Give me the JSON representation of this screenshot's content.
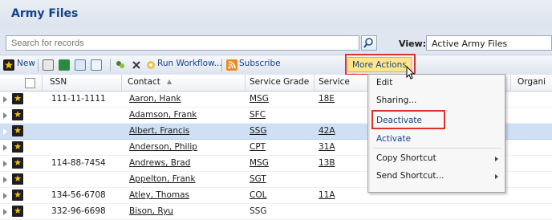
{
  "header": {
    "title": "Army Files"
  },
  "search": {
    "placeholder": "Search for records",
    "view_label": "View:",
    "view_value": "Active Army Files"
  },
  "toolbar": {
    "new_label": "New",
    "run_workflow_label": "Run Workflow...",
    "subscribe_label": "Subscribe",
    "more_actions_label": "More Actions"
  },
  "columns": [
    "SSN",
    "Contact",
    "Service Grade",
    "Service",
    "Organi"
  ],
  "rows": [
    {
      "ssn": "111-11-1111",
      "contact": "Aaron, Hank",
      "grade": "MSG",
      "service": "18E"
    },
    {
      "ssn": "",
      "contact": "Adamson, Frank",
      "grade": "SFC",
      "service": ""
    },
    {
      "ssn": "",
      "contact": "Albert, Francis",
      "grade": "SSG",
      "service": "42A"
    },
    {
      "ssn": "",
      "contact": "Anderson, Philip",
      "grade": "CPT",
      "service": "31A"
    },
    {
      "ssn": "114-88-7454",
      "contact": "Andrews, Brad",
      "grade": "MSG",
      "service": "13B"
    },
    {
      "ssn": "",
      "contact": "Appelton, Frank",
      "grade": "SGT",
      "service": ""
    },
    {
      "ssn": "134-56-6708",
      "contact": "Atley, Thomas",
      "grade": "COL",
      "service": "11A"
    },
    {
      "ssn": "332-96-6698",
      "contact": "Bison, Ryu",
      "grade": "SSG",
      "service": ""
    }
  ],
  "menu": {
    "items": [
      "Edit",
      "Sharing...",
      "Deactivate",
      "Activate",
      "Copy Shortcut",
      "Send Shortcut..."
    ]
  }
}
